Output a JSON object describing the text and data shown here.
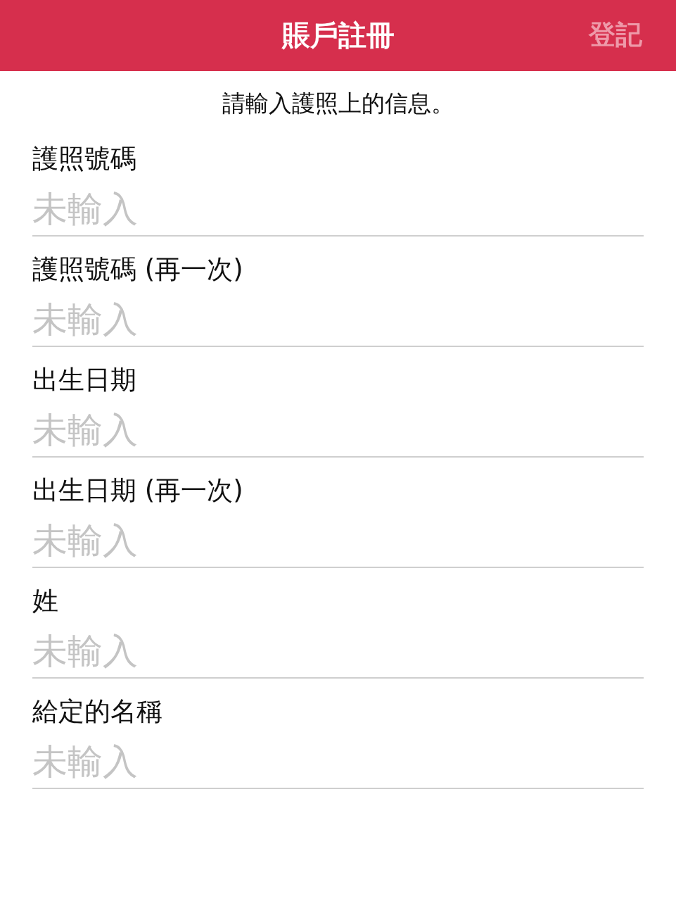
{
  "header": {
    "title": "賬戶註冊",
    "register_button": {
      "label": "登記",
      "disabled": true
    }
  },
  "instruction": "請輸入護照上的信息。",
  "fields": [
    {
      "label": "護照號碼",
      "placeholder": "未輸入"
    },
    {
      "label": "護照號碼 (再一次)",
      "placeholder": "未輸入"
    },
    {
      "label": "出生日期",
      "placeholder": "未輸入"
    },
    {
      "label": "出生日期 (再一次)",
      "placeholder": "未輸入"
    },
    {
      "label": "姓",
      "placeholder": "未輸入"
    },
    {
      "label": "給定的名稱",
      "placeholder": "未輸入"
    }
  ]
}
